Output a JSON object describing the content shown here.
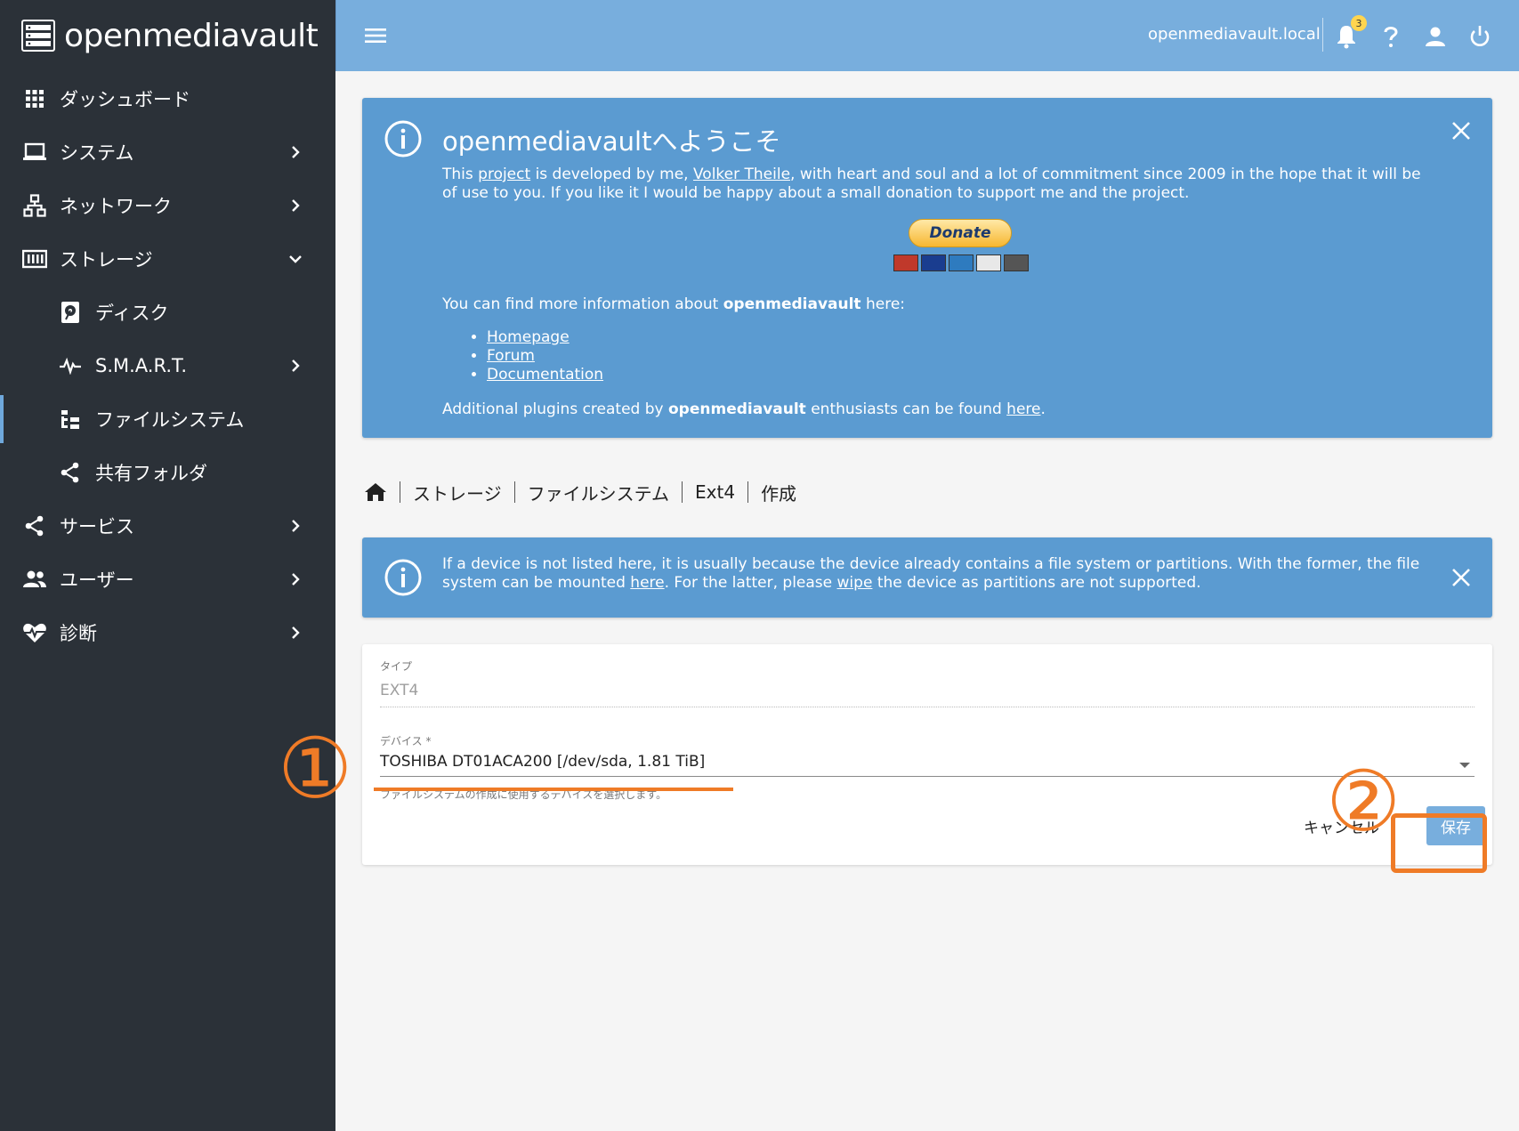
{
  "app": {
    "brand": "openmediavault",
    "host": "openmediavault.local",
    "notification_count": "3"
  },
  "sidebar": {
    "items": [
      {
        "label": "ダッシュボード",
        "icon": "grid-icon"
      },
      {
        "label": "システム",
        "icon": "laptop-icon"
      },
      {
        "label": "ネットワーク",
        "icon": "network-icon"
      },
      {
        "label": "ストレージ",
        "icon": "storage-icon"
      },
      {
        "label": "ディスク",
        "icon": "disk-icon"
      },
      {
        "label": "S.M.A.R.T.",
        "icon": "pulse-icon"
      },
      {
        "label": "ファイルシステム",
        "icon": "file-tree-icon"
      },
      {
        "label": "共有フォルダ",
        "icon": "share-icon"
      },
      {
        "label": "サービス",
        "icon": "share-icon"
      },
      {
        "label": "ユーザー",
        "icon": "users-icon"
      },
      {
        "label": "診断",
        "icon": "heart-pulse-icon"
      }
    ]
  },
  "welcome": {
    "title": "openmediavaultへようこそ",
    "p1_a": "This ",
    "p1_link1": "project",
    "p1_b": " is developed by me, ",
    "p1_link2": "Volker Theile",
    "p1_c": ", with heart and soul and a lot of commitment since 2009 in the hope that it will be of use to you. If you like it I would be happy about a small donation to support me and the project.",
    "donate_label": "Donate",
    "more_a": "You can find more information about ",
    "more_bold": "openmediavault",
    "more_b": " here:",
    "links": [
      "Homepage",
      "Forum",
      "Documentation"
    ],
    "plugins_a": "Additional plugins created by ",
    "plugins_bold": "openmediavault",
    "plugins_b": " enthusiasts can be found ",
    "plugins_link": "here",
    "plugins_c": "."
  },
  "breadcrumb": [
    "ストレージ",
    "ファイルシステム",
    "Ext4",
    "作成"
  ],
  "notice": {
    "a": "If a device is not listed here, it is usually because the device already contains a file system or partitions. With the former, the file system can be mounted ",
    "link1": "here",
    "b": ". For the latter, please ",
    "link2": "wipe",
    "c": " the device as partitions are not supported."
  },
  "form": {
    "type_label": "タイプ",
    "type_value": "EXT4",
    "device_label": "デバイス *",
    "device_value": "TOSHIBA DT01ACA200 [/dev/sda, 1.81 TiB]",
    "device_hint": "ファイルシステムの作成に使用するデバイスを選択します。",
    "cancel_label": "キャンセル",
    "save_label": "保存"
  },
  "annotations": {
    "step1": "①",
    "step2": "②",
    "color": "#ef7b27"
  },
  "colors": {
    "sidebar_bg": "#2b3138",
    "topbar_bg": "#78aedd",
    "alert_bg": "#5b9bd1"
  }
}
